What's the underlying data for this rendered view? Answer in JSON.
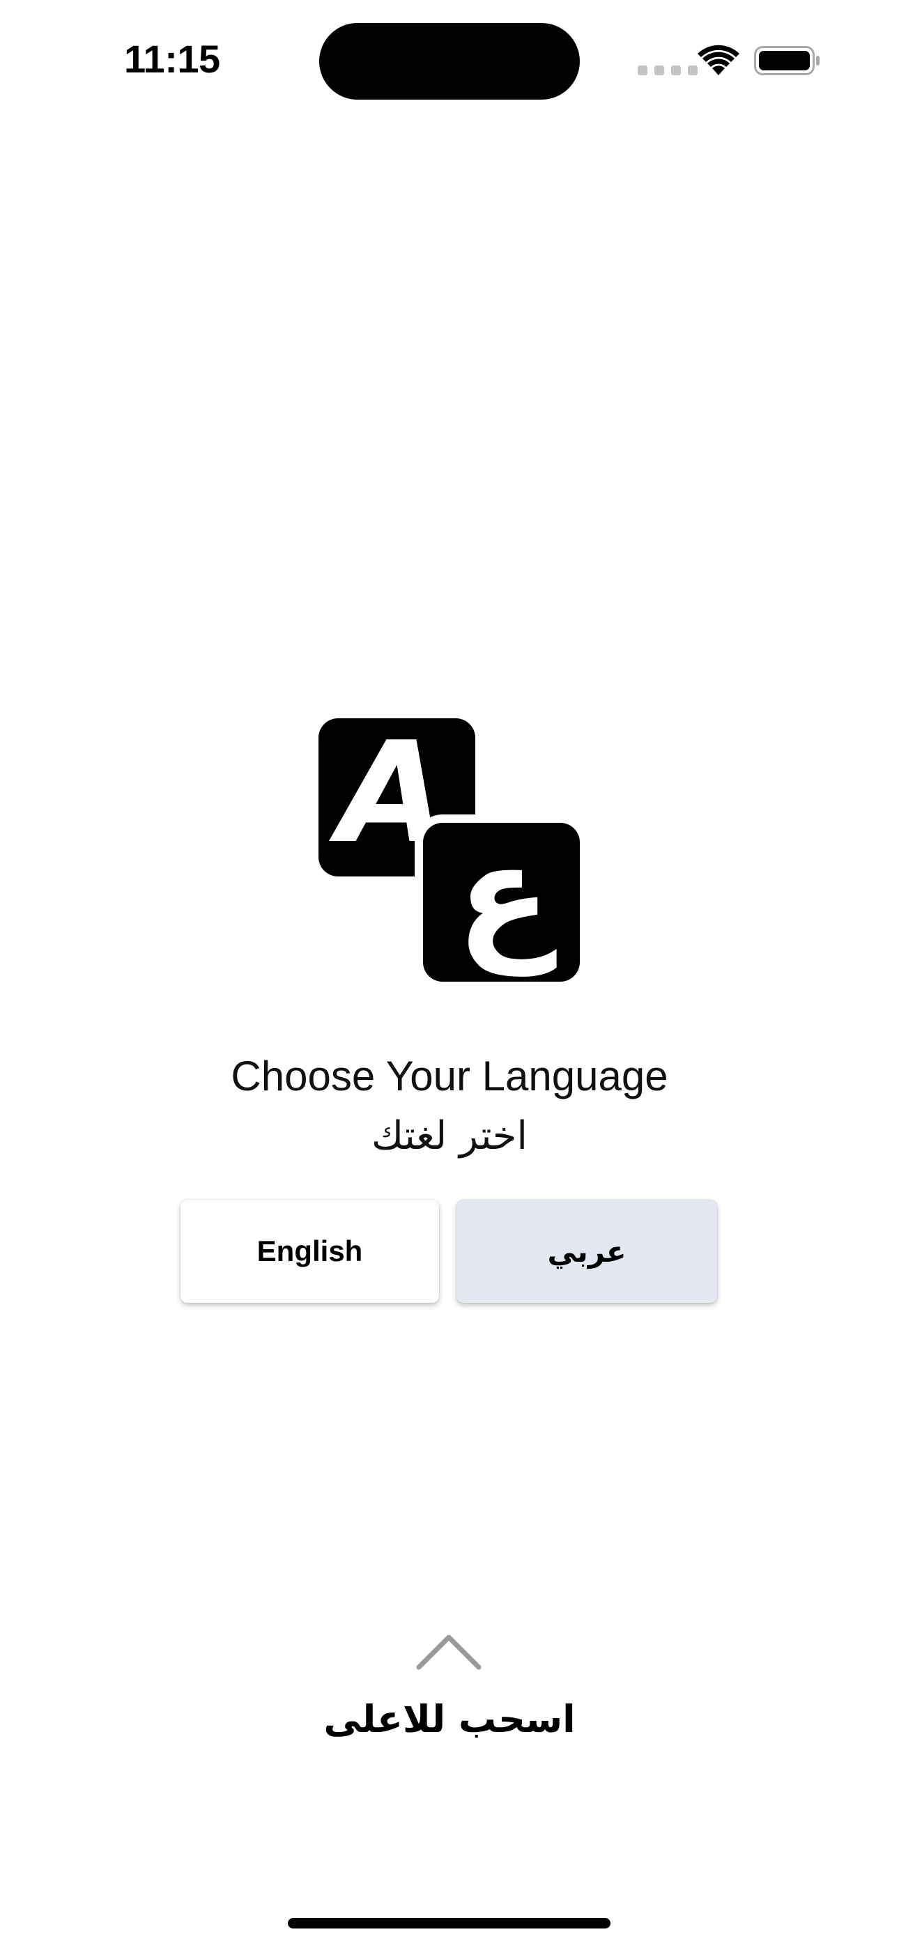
{
  "status_bar": {
    "time": "11:15",
    "icons": [
      "cellular-signal-icon",
      "wifi-icon",
      "battery-icon"
    ]
  },
  "logo": {
    "latin_glyph": "A",
    "arabic_glyph": "ع",
    "icon": "language-translate-icon"
  },
  "heading": {
    "english": "Choose Your Language",
    "arabic": "اختر لغتك"
  },
  "buttons": {
    "english_label": "English",
    "arabic_label": "عربي"
  },
  "swipe_hint": {
    "icon": "chevron-up-icon",
    "label": "اسحب للاعلى"
  },
  "colors": {
    "background": "#ffffff",
    "arabic_button_bg": "#e3e8f0",
    "english_button_bg": "#ffffff",
    "chevron": "#9a9a9a"
  }
}
